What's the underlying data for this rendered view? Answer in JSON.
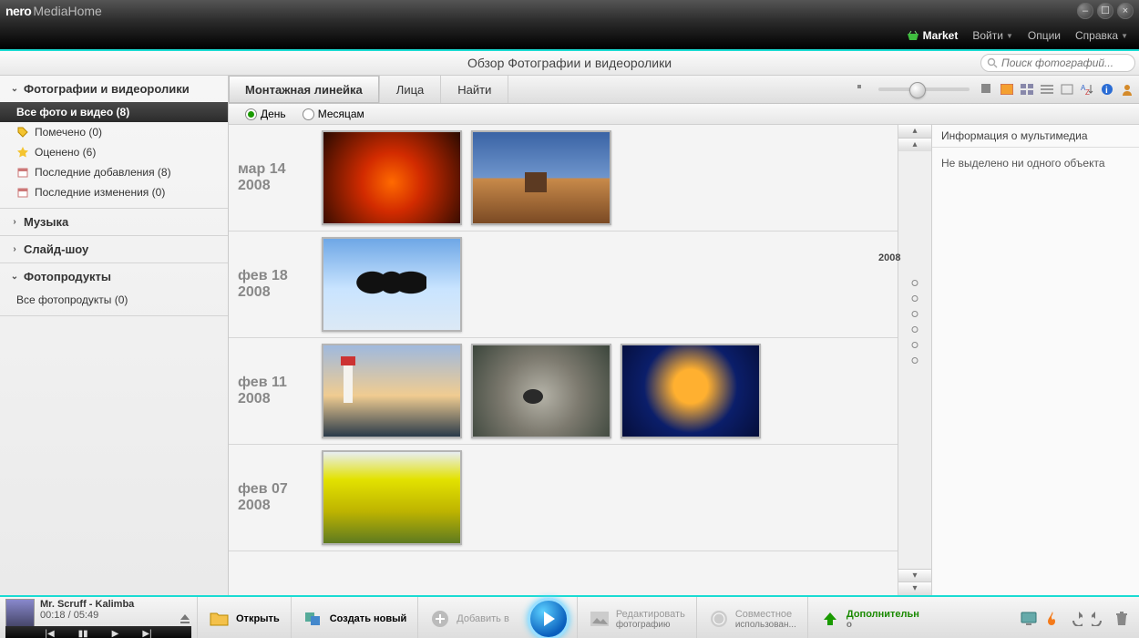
{
  "app": {
    "logo_bold": "nero",
    "logo_rest": "MediaHome"
  },
  "nav": {
    "market": "Market",
    "login": "Войти",
    "options": "Опции",
    "help": "Справка"
  },
  "overview": {
    "title": "Обзор Фотографии и видеоролики",
    "search_placeholder": "Поиск фотографий..."
  },
  "sidebar": {
    "photos": {
      "title": "Фотографии и видеоролики",
      "items": [
        {
          "label": "Все фото и видео (8)",
          "selected": true,
          "icon": "none"
        },
        {
          "label": "Помечено (0)",
          "icon": "tag"
        },
        {
          "label": "Оценено (6)",
          "icon": "star"
        },
        {
          "label": "Последние добавления (8)",
          "icon": "calendar"
        },
        {
          "label": "Последние изменения (0)",
          "icon": "calendar"
        }
      ]
    },
    "music": {
      "title": "Музыка"
    },
    "slideshow": {
      "title": "Слайд-шоу"
    },
    "photoproducts": {
      "title": "Фотопродукты",
      "items": [
        {
          "label": "Все фотопродукты (0)"
        }
      ]
    }
  },
  "tabs": {
    "timeline": "Монтажная линейка",
    "faces": "Лица",
    "find": "Найти"
  },
  "filters": {
    "day": "День",
    "month": "Месяцам"
  },
  "timeline_year": "2008",
  "groups": [
    {
      "date_top": "мар 14",
      "date_year": "2008",
      "thumbs": [
        "flower",
        "desert"
      ]
    },
    {
      "date_top": "фев 18",
      "date_year": "2008",
      "thumbs": [
        "penguins"
      ]
    },
    {
      "date_top": "фев 11",
      "date_year": "2008",
      "thumbs": [
        "lighthouse",
        "koala",
        "jellyfish"
      ]
    },
    {
      "date_top": "фев 07",
      "date_year": "2008",
      "thumbs": [
        "tulips"
      ]
    }
  ],
  "info": {
    "header": "Информация о мультимедиа",
    "body": "Не выделено ни одного объекта"
  },
  "player": {
    "track": "Mr. Scruff - Kalimba",
    "time": "00:18 / 05:49"
  },
  "actions": {
    "open": "Открыть",
    "create": "Создать новый",
    "add": "Добавить в",
    "edit_top": "Редактировать",
    "edit_bot": "фотографию",
    "share_top": "Совместное",
    "share_bot": "использован...",
    "more_top": "Дополнительн",
    "more_bot": "о"
  }
}
